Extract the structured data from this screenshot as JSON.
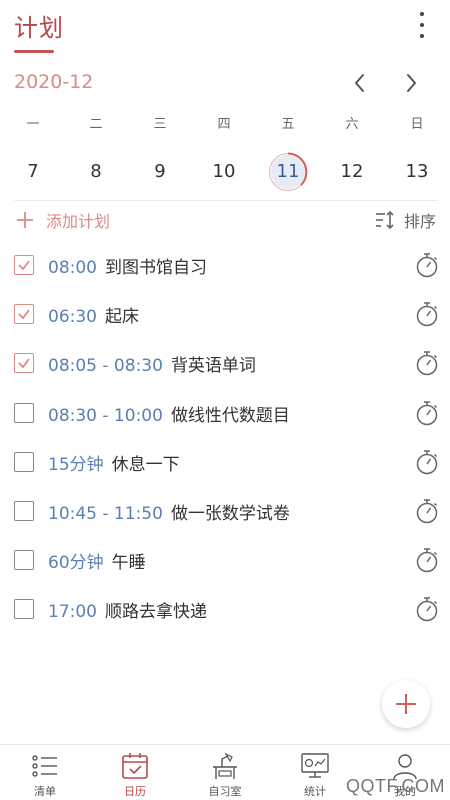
{
  "header": {
    "title": "计划"
  },
  "calendar": {
    "month": "2020-12",
    "weekdays": [
      "一",
      "二",
      "三",
      "四",
      "五",
      "六",
      "日"
    ],
    "dates": [
      "7",
      "8",
      "9",
      "10",
      "11",
      "12",
      "13"
    ],
    "selected_index": 4
  },
  "actions": {
    "add_label": "添加计划",
    "sort_label": "排序"
  },
  "tasks": [
    {
      "time": "08:00",
      "title": "到图书馆自习",
      "checked": true
    },
    {
      "time": "06:30",
      "title": "起床",
      "checked": true
    },
    {
      "time": "08:05 - 08:30",
      "title": "背英语单词",
      "checked": true
    },
    {
      "time": "08:30 - 10:00",
      "title": "做线性代数题目",
      "checked": false
    },
    {
      "time": "15分钟",
      "title": "休息一下",
      "checked": false
    },
    {
      "time": "10:45 - 11:50",
      "title": "做一张数学试卷",
      "checked": false
    },
    {
      "time": "60分钟",
      "title": "午睡",
      "checked": false
    },
    {
      "time": "17:00",
      "title": "顺路去拿快递",
      "checked": false
    }
  ],
  "bottom_nav": [
    {
      "label": "清单",
      "icon": "list-icon",
      "active": false
    },
    {
      "label": "日历",
      "icon": "calendar-icon",
      "active": true
    },
    {
      "label": "自习室",
      "icon": "study-room-icon",
      "active": false
    },
    {
      "label": "统计",
      "icon": "stats-icon",
      "active": false
    },
    {
      "label": "我的",
      "icon": "user-icon",
      "active": false
    }
  ],
  "watermark": "QQTF.COM",
  "colors": {
    "accent": "#b5484c",
    "accent_light": "#d98b88",
    "time_blue": "#5b7fb5"
  }
}
